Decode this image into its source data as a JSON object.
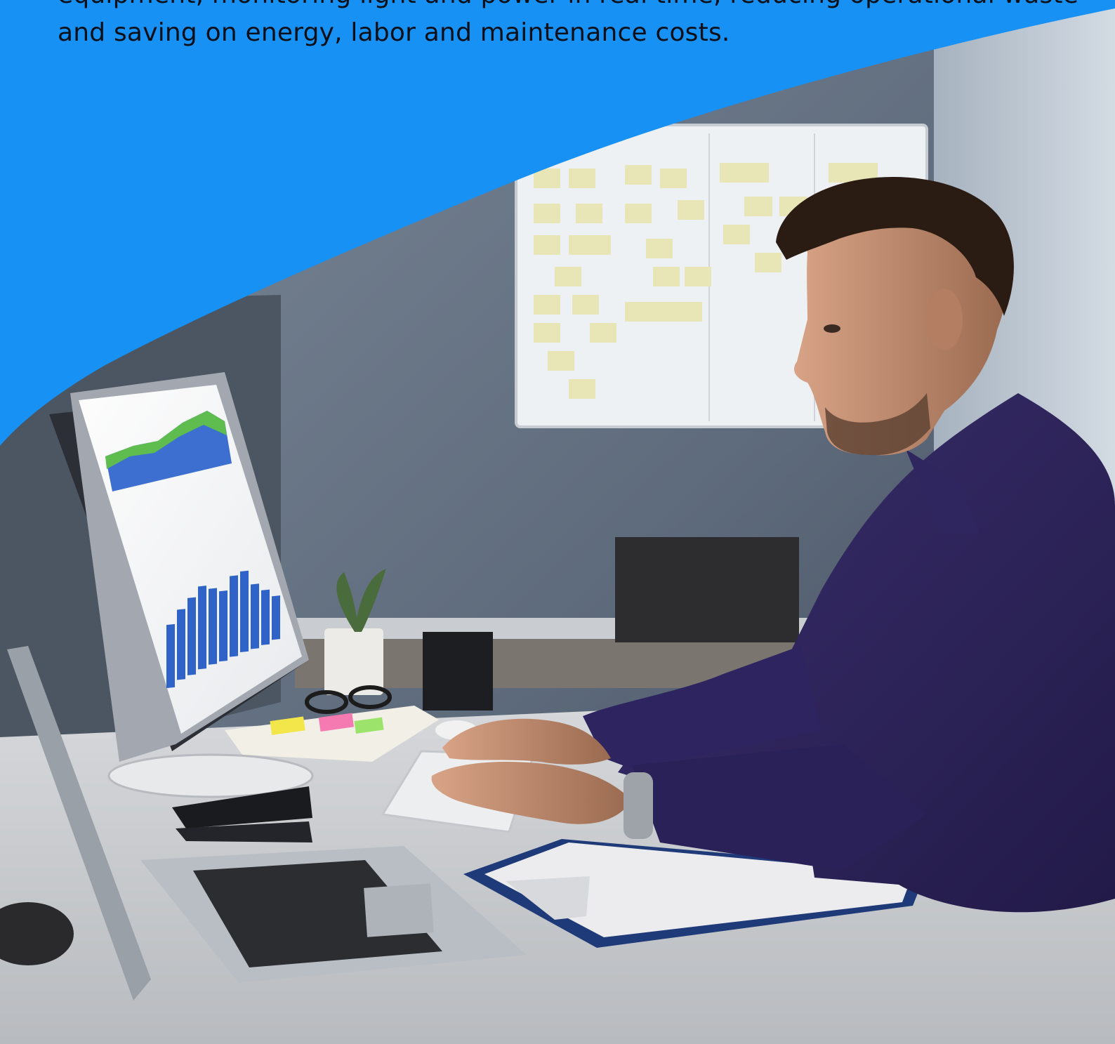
{
  "intro": {
    "line_partial": "equipment, monitoring light and power in real time, reducing operational waste",
    "line_full": "and saving on energy, labor and maintenance costs."
  },
  "colors": {
    "brand_blue": "#1791f4",
    "text_dark": "#0b0f17"
  },
  "hero_image": {
    "icon": "office-analyst-photo"
  }
}
